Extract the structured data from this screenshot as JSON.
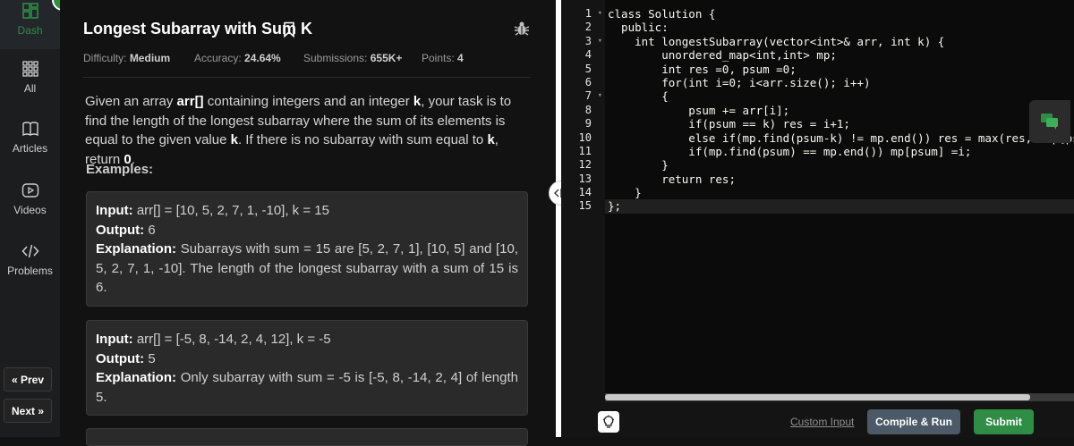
{
  "sidebar": {
    "items": [
      {
        "label": "Dash",
        "icon": "dashboard-icon"
      },
      {
        "label": "All",
        "icon": "grid-icon"
      },
      {
        "label": "Articles",
        "icon": "book-icon"
      },
      {
        "label": "Videos",
        "icon": "video-icon"
      },
      {
        "label": "Problems",
        "icon": "code-icon"
      }
    ],
    "prev_label": "« Prev",
    "next_label": "Next »"
  },
  "problem": {
    "title": "Longest Subarray with Sum K",
    "difficulty_label": "Difficulty:",
    "difficulty": "Medium",
    "accuracy_label": "Accuracy:",
    "accuracy": "24.64%",
    "submissions_label": "Submissions:",
    "submissions": "655K+",
    "points_label": "Points:",
    "points": "4",
    "description": {
      "p1": "Given an array ",
      "arr": "arr[]",
      "p2": " containing integers and an integer ",
      "k1": "k",
      "p3": ", your task is to find the length of the longest subarray where the sum of its elements is equal to the given value ",
      "k2": "k",
      "p4": ". If there is no subarray with sum equal to ",
      "k3": "k",
      "p5": ", return ",
      "zero": "0",
      "p6": "."
    },
    "examples_heading": "Examples:",
    "examples": [
      {
        "input_label": "Input:",
        "input": "arr[] = [10, 5, 2, 7, 1, -10], k = 15",
        "output_label": "Output:",
        "output": "6",
        "explanation_label": "Explanation:",
        "explanation": "Subarrays with sum = 15 are [5, 2, 7, 1], [10, 5] and [10, 5, 2, 7, 1, -10]. The length of the longest subarray with a sum of 15 is 6."
      },
      {
        "input_label": "Input:",
        "input": "arr[] = [-5, 8, -14, 2, 4, 12], k = -5",
        "output_label": "Output:",
        "output": "5",
        "explanation_label": "Explanation:",
        "explanation": "Only subarray with sum = -5 is [-5, 8, -14, 2, 4] of length 5."
      }
    ]
  },
  "editor": {
    "line_numbers": [
      "1",
      "2",
      "3",
      "4",
      "5",
      "6",
      "7",
      "8",
      "9",
      "10",
      "11",
      "12",
      "13",
      "14",
      "15"
    ],
    "code_lines": [
      "class Solution {",
      "  public:",
      "    int longestSubarray(vector<int>& arr, int k) {",
      "        unordered_map<int,int> mp;",
      "        int res =0, psum =0;",
      "        for(int i=0; i<arr.size(); i++)",
      "        {",
      "            psum += arr[i];",
      "            if(psum == k) res = i+1;",
      "            else if(mp.find(psum-k) != mp.end()) res = max(res,i-mp[psum-k]);",
      "            if(mp.find(psum) == mp.end()) mp[psum] =i;",
      "        }",
      "        return res;",
      "    }",
      "};"
    ],
    "custom_input_label": "Custom Input",
    "compile_run_label": "Compile & Run",
    "submit_label": "Submit"
  },
  "colors": {
    "accent_green": "#2f8d46",
    "run_button": "#4b5a66"
  }
}
